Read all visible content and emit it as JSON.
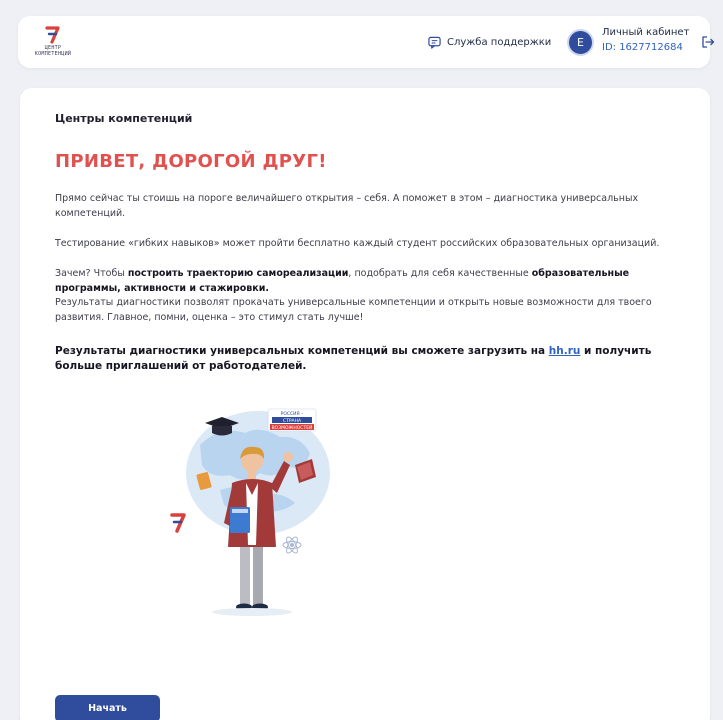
{
  "header": {
    "logo_text": "ЦЕНТР КОМПЕТЕНЦИЙ",
    "support_label": "Служба поддержки",
    "avatar_letter": "Е",
    "cabinet_title": "Личный кабинет",
    "cabinet_id": "ID: 1627712684"
  },
  "main": {
    "breadcrumb": "Центры компетенций",
    "title": "ПРИВЕТ, ДОРОГОЙ ДРУГ!",
    "p1": "Прямо сейчас ты стоишь на пороге величайшего открытия – себя. А поможет в этом – диагностика универсальных компетенций.",
    "p2": "Тестирование «гибких навыков» может пройти бесплатно каждый студент российских образовательных организаций.",
    "p3_a": "Зачем? Чтобы ",
    "p3_b": "построить траекторию самореализации",
    "p3_c": ", подобрать для себя качественные ",
    "p3_d": "образовательные программы, активности и стажировки.",
    "p4": "Результаты диагностики позволят прокачать универсальные компетенции и открыть новые возможности для твоего развития. Главное, помни, оценка – это стимул стать лучше!",
    "bold_a": "Результаты диагностики универсальных компетенций вы сможете загрузить на ",
    "bold_link": "hh.ru",
    "bold_b": " и получить больше приглашений от работодателей.",
    "illustration_sign": [
      "РОССИЯ –",
      "СТРАНА",
      "ВОЗМОЖНОСТЕЙ"
    ],
    "start_button": "Начать"
  },
  "colors": {
    "accent": "#2f4d9c",
    "title_red": "#e0524f",
    "link": "#2f62c2"
  },
  "icons": {
    "support": "chat-bubble-icon",
    "logout": "logout-arrow-icon"
  }
}
